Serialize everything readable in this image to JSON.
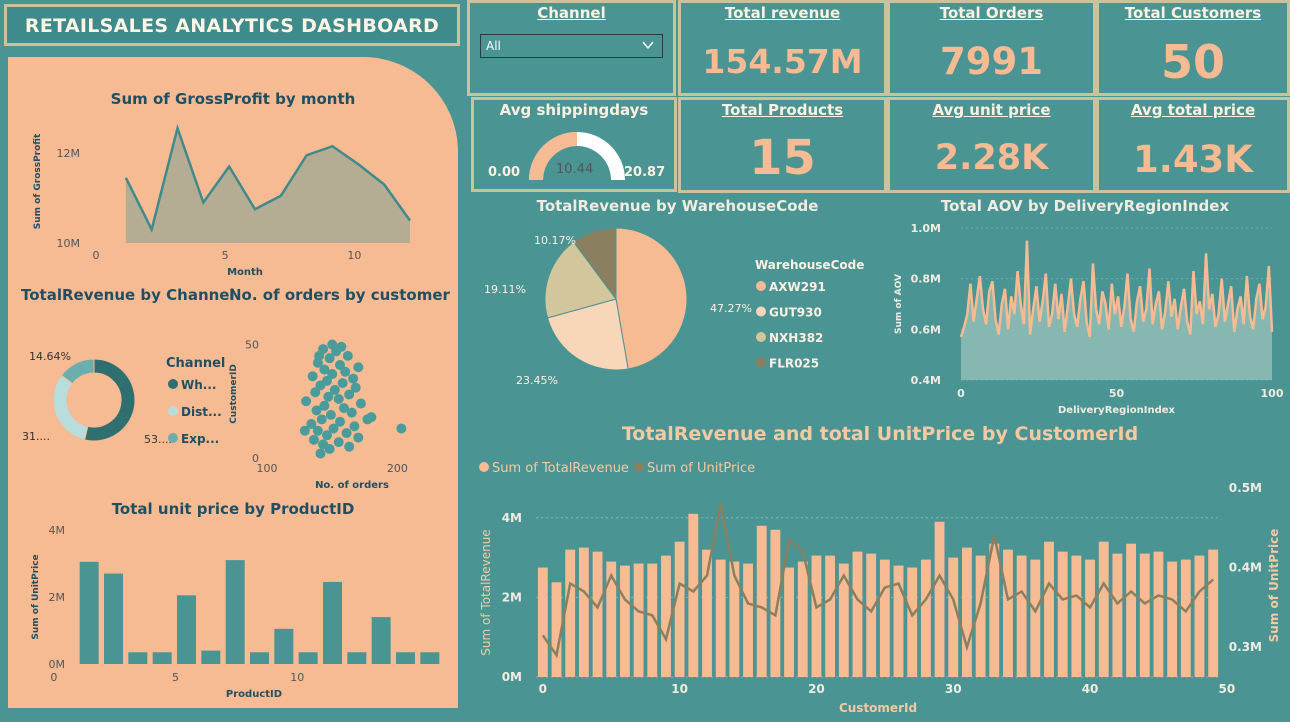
{
  "header": {
    "title": "RETAILSALES ANALYTICS DASHBOARD"
  },
  "slicer": {
    "title": "Channel",
    "value": "All"
  },
  "kpis": {
    "total_revenue": {
      "label": "Total revenue",
      "value": "154.57M"
    },
    "total_orders": {
      "label": "Total Orders",
      "value": "7991"
    },
    "total_customers": {
      "label": "Total Customers",
      "value": "50"
    },
    "total_products": {
      "label": "Total Products",
      "value": "15"
    },
    "avg_unit_price": {
      "label": "Avg unit price",
      "value": "2.28K"
    },
    "avg_total_price": {
      "label": "Avg total price",
      "value": "1.43K"
    }
  },
  "gauge": {
    "title": "Avg shippingdays",
    "min": "0.00",
    "max": "20.87",
    "value": "10.44",
    "value_num": 10.44,
    "max_num": 20.87
  },
  "colors": {
    "teal": "#4a9494",
    "peach": "#f7bb93",
    "dark_teal": "#2f6f6f",
    "olive": "#8a8060",
    "light_peach": "#f8d6ba",
    "tan": "#d4c69c",
    "navy": "#1f4f63",
    "border": "#c8c39a"
  },
  "chart_data": [
    {
      "id": "gross_profit",
      "type": "area",
      "title": "Sum of GrossProfit by month",
      "xlabel": "Month",
      "ylabel": "Sum of GrossProfit",
      "x": [
        1,
        2,
        3,
        4,
        5,
        6,
        7,
        8,
        9,
        10,
        11,
        12
      ],
      "values": [
        11.45,
        10.3,
        12.55,
        10.9,
        11.7,
        10.75,
        11.05,
        11.95,
        12.15,
        11.75,
        11.3,
        10.5
      ],
      "xlim": [
        0,
        12
      ],
      "ylim": [
        10,
        13
      ],
      "xticks": [
        "0",
        "5",
        "10"
      ],
      "yticks": [
        "10M",
        "12M"
      ]
    },
    {
      "id": "revenue_channel",
      "type": "pie",
      "title": "TotalRevenue by Channel",
      "legend_title": "Channel",
      "categories": [
        "Wh...",
        "Dist...",
        "Exp..."
      ],
      "values": [
        53.7,
        31.66,
        14.64
      ],
      "value_labels": [
        "53....",
        "31....",
        "14.64%"
      ]
    },
    {
      "id": "orders_customer",
      "type": "scatter",
      "title": "No. of orders by customer",
      "xlabel": "No. of orders",
      "ylabel": "CustomerID",
      "xticks": [
        "100",
        "200"
      ],
      "yticks": [
        "0",
        "50"
      ],
      "xlim": [
        100,
        215
      ],
      "ylim": [
        0,
        52
      ],
      "points": [
        [
          150,
          50
        ],
        [
          157,
          49
        ],
        [
          143,
          48
        ],
        [
          153,
          47
        ],
        [
          140,
          45
        ],
        [
          162,
          45
        ],
        [
          148,
          44
        ],
        [
          139,
          42
        ],
        [
          156,
          41
        ],
        [
          170,
          40
        ],
        [
          144,
          39
        ],
        [
          160,
          38
        ],
        [
          150,
          37
        ],
        [
          135,
          36
        ],
        [
          166,
          35
        ],
        [
          146,
          34
        ],
        [
          158,
          33
        ],
        [
          141,
          32
        ],
        [
          168,
          31
        ],
        [
          152,
          30
        ],
        [
          137,
          29
        ],
        [
          163,
          28
        ],
        [
          147,
          27
        ],
        [
          155,
          26
        ],
        [
          130,
          25
        ],
        [
          172,
          24
        ],
        [
          144,
          23
        ],
        [
          159,
          22
        ],
        [
          138,
          21
        ],
        [
          165,
          20
        ],
        [
          149,
          19
        ],
        [
          180,
          18
        ],
        [
          142,
          17
        ],
        [
          156,
          16
        ],
        [
          134,
          15
        ],
        [
          167,
          14
        ],
        [
          151,
          13
        ],
        [
          139,
          12
        ],
        [
          161,
          11
        ],
        [
          146,
          10
        ],
        [
          170,
          9
        ],
        [
          136,
          8
        ],
        [
          155,
          7
        ],
        [
          143,
          6
        ],
        [
          163,
          5
        ],
        [
          148,
          4
        ],
        [
          203,
          13
        ],
        [
          129,
          12
        ],
        [
          177,
          17
        ],
        [
          141,
          2
        ]
      ]
    },
    {
      "id": "unit_price_product",
      "type": "bar",
      "title": "Total unit price by ProductID",
      "xlabel": "ProductID",
      "ylabel": "Sum of UnitPrice",
      "x": [
        1,
        2,
        3,
        4,
        5,
        6,
        7,
        8,
        9,
        10,
        11,
        12,
        13,
        14,
        15
      ],
      "values": [
        3.05,
        2.7,
        0.35,
        0.35,
        2.05,
        0.4,
        3.1,
        0.35,
        1.05,
        0.35,
        2.45,
        0.35,
        1.4,
        0.35,
        0.35
      ],
      "ylim": [
        0,
        4
      ],
      "xticks": [
        "0",
        "5",
        "10"
      ],
      "yticks": [
        "0M",
        "2M",
        "4M"
      ]
    },
    {
      "id": "revenue_warehouse",
      "type": "pie",
      "title": "TotalRevenue by WarehouseCode",
      "legend_title": "WarehouseCode",
      "categories": [
        "AXW291",
        "GUT930",
        "NXH382",
        "FLR025"
      ],
      "values": [
        47.27,
        23.45,
        19.11,
        10.17
      ],
      "value_labels": [
        "47.27%",
        "23.45%",
        "19.11%",
        "10.17%"
      ]
    },
    {
      "id": "aov_region",
      "type": "area",
      "title": "Total AOV by DeliveryRegionIndex",
      "xlabel": "DeliveryRegionIndex",
      "ylabel": "Sum of AOV",
      "xlim": [
        0,
        100
      ],
      "ylim": [
        0.4,
        1.0
      ],
      "xticks": [
        "0",
        "50",
        "100"
      ],
      "yticks": [
        "0.4M",
        "0.6M",
        "0.8M",
        "1.0M"
      ],
      "values": [
        0.57,
        0.61,
        0.66,
        0.78,
        0.63,
        0.72,
        0.81,
        0.68,
        0.62,
        0.75,
        0.79,
        0.64,
        0.58,
        0.7,
        0.76,
        0.6,
        0.73,
        0.66,
        0.83,
        0.7,
        0.62,
        0.95,
        0.58,
        0.68,
        0.77,
        0.63,
        0.71,
        0.82,
        0.61,
        0.66,
        0.78,
        0.64,
        0.74,
        0.59,
        0.69,
        0.8,
        0.66,
        0.61,
        0.72,
        0.79,
        0.63,
        0.57,
        0.86,
        0.68,
        0.62,
        0.75,
        0.7,
        0.6,
        0.78,
        0.66,
        0.73,
        0.61,
        0.69,
        0.82,
        0.64,
        0.59,
        0.71,
        0.77,
        0.63,
        0.68,
        0.84,
        0.62,
        0.7,
        0.75,
        0.6,
        0.67,
        0.79,
        0.65,
        0.72,
        0.6,
        0.69,
        0.76,
        0.63,
        0.58,
        0.83,
        0.66,
        0.71,
        0.62,
        0.9,
        0.68,
        0.74,
        0.61,
        0.66,
        0.8,
        0.63,
        0.7,
        0.77,
        0.59,
        0.68,
        0.73,
        0.62,
        0.81,
        0.65,
        0.6,
        0.72,
        0.78,
        0.64,
        0.69,
        0.85,
        0.59
      ]
    },
    {
      "id": "revenue_unitprice_customer",
      "type": "bar",
      "title": "TotalRevenue and total UnitPrice by CustomerId",
      "xlabel": "CustomerId",
      "ylabel": "Sum of TotalRevenue",
      "ylabel2": "Sum of UnitPrice",
      "series": [
        {
          "name": "Sum of TotalRevenue",
          "values": [
            2.75,
            2.38,
            3.2,
            3.25,
            3.15,
            2.9,
            2.8,
            2.85,
            2.85,
            3.05,
            3.4,
            4.1,
            3.2,
            2.95,
            2.9,
            2.85,
            3.8,
            3.7,
            2.75,
            2.9,
            3.05,
            3.05,
            2.85,
            3.15,
            3.1,
            2.95,
            2.8,
            2.75,
            2.95,
            3.9,
            3.0,
            3.25,
            3.05,
            3.35,
            3.2,
            3.05,
            2.95,
            3.4,
            3.15,
            3.05,
            2.95,
            3.4,
            3.1,
            3.35,
            3.1,
            3.15,
            2.9,
            2.95,
            3.05,
            3.2
          ]
        },
        {
          "name": "Sum of UnitPrice",
          "values": [
            0.315,
            0.29,
            0.38,
            0.37,
            0.35,
            0.39,
            0.36,
            0.345,
            0.34,
            0.31,
            0.38,
            0.37,
            0.39,
            0.48,
            0.39,
            0.355,
            0.35,
            0.34,
            0.435,
            0.42,
            0.35,
            0.36,
            0.39,
            0.36,
            0.345,
            0.375,
            0.38,
            0.34,
            0.36,
            0.39,
            0.36,
            0.3,
            0.355,
            0.44,
            0.36,
            0.37,
            0.345,
            0.38,
            0.36,
            0.365,
            0.35,
            0.38,
            0.355,
            0.37,
            0.355,
            0.365,
            0.36,
            0.345,
            0.37,
            0.385
          ]
        }
      ],
      "xlim": [
        0,
        50
      ],
      "ylim": [
        0,
        5
      ],
      "ylim2": [
        0.25,
        0.5
      ],
      "xticks": [
        "0",
        "10",
        "20",
        "30",
        "40",
        "50"
      ],
      "yticks": [
        "0M",
        "2M",
        "4M"
      ],
      "yticks2": [
        "0.3M",
        "0.4M",
        "0.5M"
      ]
    }
  ]
}
